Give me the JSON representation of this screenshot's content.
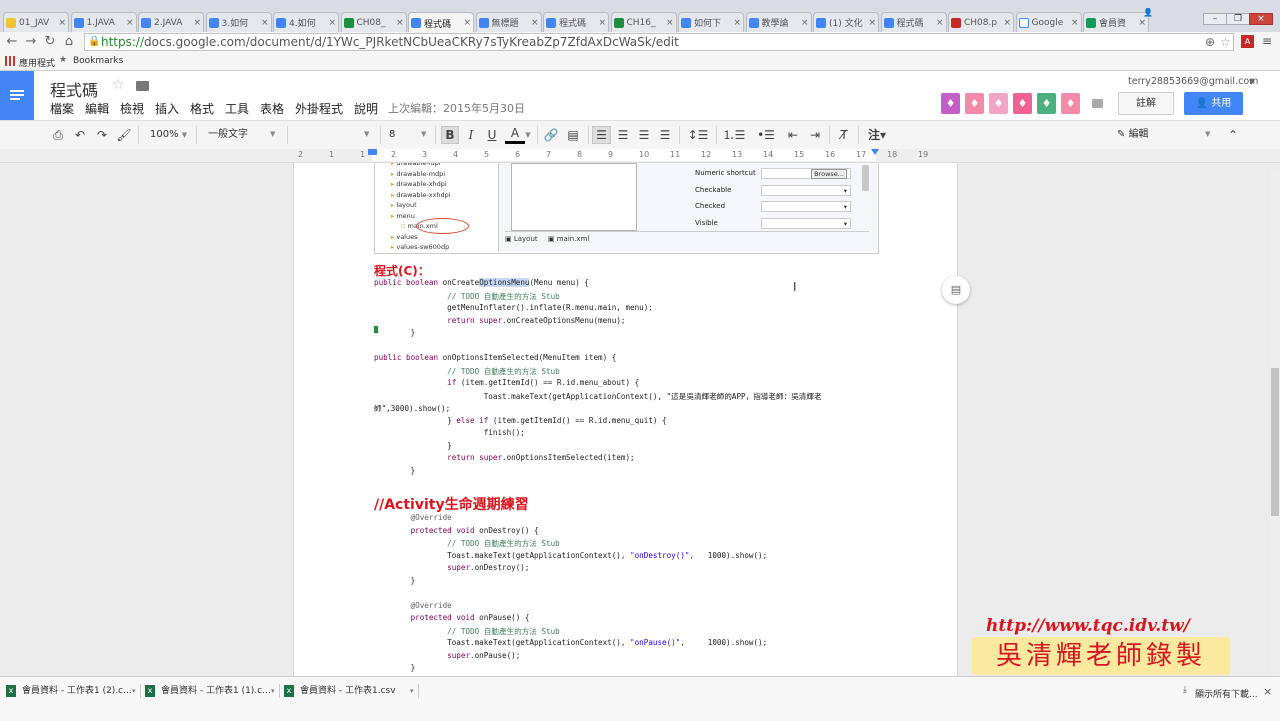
{
  "browser": {
    "tabs": [
      {
        "label": "01_JAV",
        "favicon": "#f1c232"
      },
      {
        "label": "1.JAVA",
        "favicon": "#4285f4"
      },
      {
        "label": "2.JAVA",
        "favicon": "#4285f4"
      },
      {
        "label": "3.如何",
        "favicon": "#4285f4"
      },
      {
        "label": "4.如何",
        "favicon": "#4285f4"
      },
      {
        "label": "CH08_",
        "favicon": "#1e8e3e"
      },
      {
        "label": "程式碼",
        "favicon": "#4285f4"
      },
      {
        "label": "無標題",
        "favicon": "#4285f4"
      },
      {
        "label": "程式碼",
        "favicon": "#4285f4"
      },
      {
        "label": "CH16_",
        "favicon": "#1e8e3e"
      },
      {
        "label": "如何下",
        "favicon": "#4285f4"
      },
      {
        "label": "教學論",
        "favicon": "#4285f4"
      },
      {
        "label": "(1) 文化",
        "favicon": "#4285f4"
      },
      {
        "label": "程式碼",
        "favicon": "#4285f4"
      },
      {
        "label": "CH08.p",
        "favicon": "#c62828"
      },
      {
        "label": "Google",
        "favicon": "#ffffff"
      },
      {
        "label": "會員資",
        "favicon": "#0f9d58"
      }
    ],
    "close_glyph": "×",
    "url_scheme": "https://",
    "url_rest": "docs.google.com/document/d/1YWc_PJRketNCbUeaCKRy7sTyKreabZp7ZfdAxDcWaSk/edit",
    "bookmarks": [
      {
        "label": "應用程式",
        "icon": "apps-grid-icon"
      },
      {
        "label": "Bookmarks",
        "icon": "star-icon"
      }
    ]
  },
  "docs": {
    "title": "程式碼",
    "menus": [
      "檔案",
      "編輯",
      "檢視",
      "插入",
      "格式",
      "工具",
      "表格",
      "外掛程式",
      "說明"
    ],
    "last_edit": "上次編輯：2015年5月30日",
    "account_email": "terry28853669@gmail.com",
    "comments_label": "註解",
    "share_label": "共用",
    "extension_colors": [
      "#c35ec9",
      "#f28aa8",
      "#f0a5c5",
      "#f06292",
      "#4caf7f",
      "#f28aa8"
    ]
  },
  "toolbar": {
    "zoom": "100%",
    "style": "一般文字",
    "font_size": "8",
    "edit_mode": "編輯"
  },
  "ruler": {
    "numbers": [
      "2",
      "1",
      "1",
      "2",
      "3",
      "4",
      "5",
      "6",
      "7",
      "8",
      "9",
      "10",
      "11",
      "12",
      "13",
      "14",
      "15",
      "16",
      "17",
      "18",
      "19"
    ]
  },
  "document": {
    "tree_items": [
      "drawable-ldpi",
      "drawable-mdpi",
      "drawable-xhdpi",
      "drawable-xxhdpi",
      "layout",
      "menu",
      "main.xml",
      "values",
      "values-sw600dp"
    ],
    "props": [
      {
        "label": "Numeric shortcut",
        "value": "Browse..."
      },
      {
        "label": "Checkable",
        "value": ""
      },
      {
        "label": "Checked",
        "value": ""
      },
      {
        "label": "Visible",
        "value": ""
      }
    ],
    "bottom_tabs": [
      "Layout",
      "main.xml"
    ],
    "heading_c": "程式(C)：",
    "code1": [
      "public boolean onCreateOptionsMenu(Menu menu) {",
      "                // TODO 自動產生的方法 Stub",
      "                getMenuInflater().inflate(R.menu.main, menu);",
      "                return super.onCreateOptionsMenu(menu);",
      "        }",
      "",
      "public boolean onOptionsItemSelected(MenuItem item) {",
      "                // TODO 自動產生的方法 Stub",
      "                if (item.getItemId() == R.id.menu_about) {",
      "                        Toast.makeText(getApplicationContext(), \"這是吳清輝老師的APP，指導老師：吳清輝老",
      "師\",3000).show();",
      "                } else if (item.getItemId() == R.id.menu_quit) {",
      "                        finish();",
      "                }",
      "                return super.onOptionsItemSelected(item);",
      "        }"
    ],
    "heading_lifecycle": "//Activity生命週期練習",
    "code2": [
      "        @Override",
      "        protected void onDestroy() {",
      "                // TODO 自動產生的方法 Stub",
      "                Toast.makeText(getApplicationContext(), \"onDestroy()\",   1000).show();",
      "                super.onDestroy();",
      "        }",
      "",
      "        @Override",
      "        protected void onPause() {",
      "                // TODO 自動產生的方法 Stub",
      "                Toast.makeText(getApplicationContext(), \"onPause()\",     1000).show();",
      "                super.onPause();",
      "        }"
    ]
  },
  "downloads": {
    "items": [
      "會員資料 - 工作表1 (2).c...",
      "會員資料 - 工作表1 (1).c...",
      "會員資料 - 工作表1.csv"
    ],
    "show_all": "顯示所有下載..."
  },
  "watermark": {
    "url": "http://www.tqc.idv.tw/",
    "name": "吳清輝老師錄製"
  }
}
